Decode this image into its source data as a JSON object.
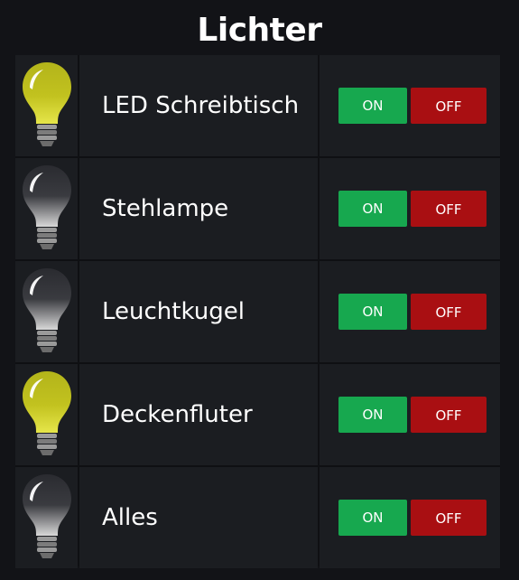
{
  "title": "Lichter",
  "colors": {
    "background": "#121317",
    "row": "#1b1d21",
    "on_button": "#17a84f",
    "off_button": "#a90f12",
    "bulb_lit": "#c8c81a",
    "bulb_unlit": "#2b2c31"
  },
  "lights": [
    {
      "label": "LED Schreibtisch",
      "on_label": "ON",
      "off_label": "OFF",
      "state": "on",
      "icon": "lightbulb-on-icon"
    },
    {
      "label": "Stehlampe",
      "on_label": "ON",
      "off_label": "OFF",
      "state": "off",
      "icon": "lightbulb-off-icon"
    },
    {
      "label": "Leuchtkugel",
      "on_label": "ON",
      "off_label": "OFF",
      "state": "off",
      "icon": "lightbulb-off-icon"
    },
    {
      "label": "Deckenfluter",
      "on_label": "ON",
      "off_label": "OFF",
      "state": "on",
      "icon": "lightbulb-on-icon"
    },
    {
      "label": "Alles",
      "on_label": "ON",
      "off_label": "OFF",
      "state": "off",
      "icon": "lightbulb-off-icon"
    }
  ]
}
